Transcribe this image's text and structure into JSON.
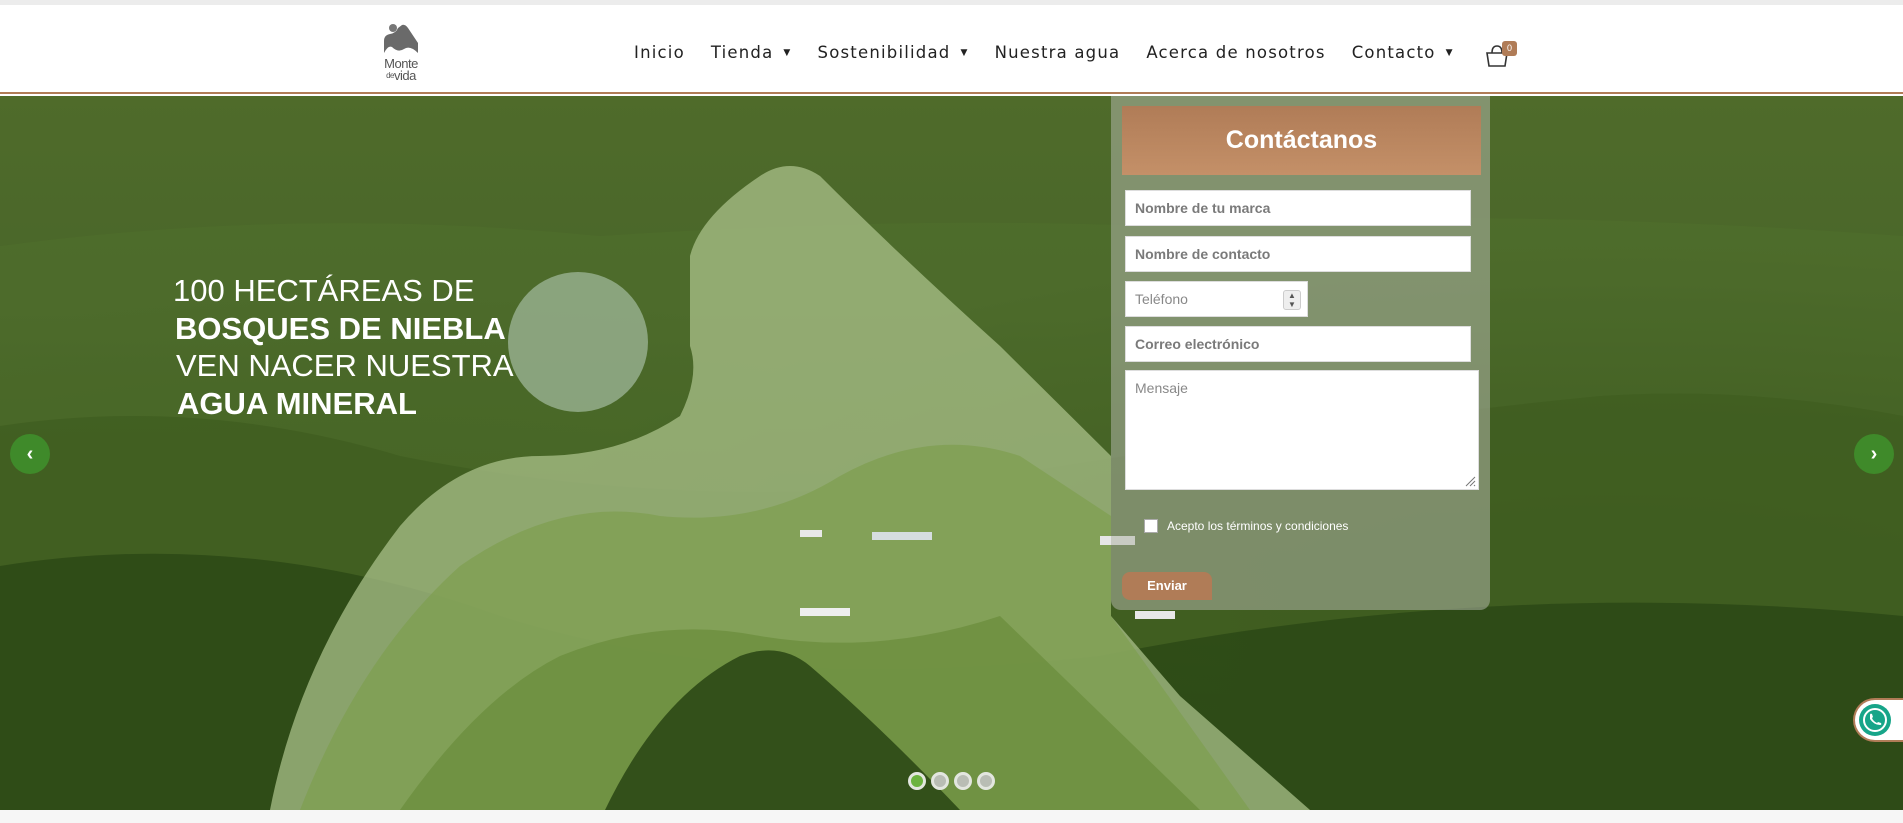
{
  "header": {
    "logo_text_top": "Monte",
    "logo_text_small": "de",
    "logo_text_bottom": "vida"
  },
  "nav": {
    "items": [
      {
        "label": "Inicio",
        "dropdown": false
      },
      {
        "label": "Tienda",
        "dropdown": true
      },
      {
        "label": "Sostenibilidad",
        "dropdown": true
      },
      {
        "label": "Nuestra agua",
        "dropdown": false
      },
      {
        "label": "Acerca de nosotros",
        "dropdown": false
      },
      {
        "label": "Contacto",
        "dropdown": true
      }
    ],
    "caret": "▼",
    "cart_count": "0"
  },
  "hero": {
    "line1": "100 HECTÁREAS DE",
    "line2": "BOSQUES DE NIEBLA",
    "line3": "VEN NACER NUESTRA",
    "line4": "AGUA MINERAL",
    "prev_arrow": "‹",
    "next_arrow": "›",
    "active_slide": 1,
    "slide_count": 4
  },
  "contact_form": {
    "title": "Contáctanos",
    "brand_placeholder": "Nombre de tu marca",
    "contact_placeholder": "Nombre de contacto",
    "phone_placeholder": "Teléfono",
    "email_placeholder": "Correo electrónico",
    "message_placeholder": "Mensaje",
    "terms_label": "Acepto los términos y condiciones",
    "submit_label": "Enviar"
  },
  "colors": {
    "accent": "#b07c57",
    "arrow_green": "#3f8a2a",
    "dot_active": "#6cb33f",
    "whatsapp": "#17a589"
  }
}
